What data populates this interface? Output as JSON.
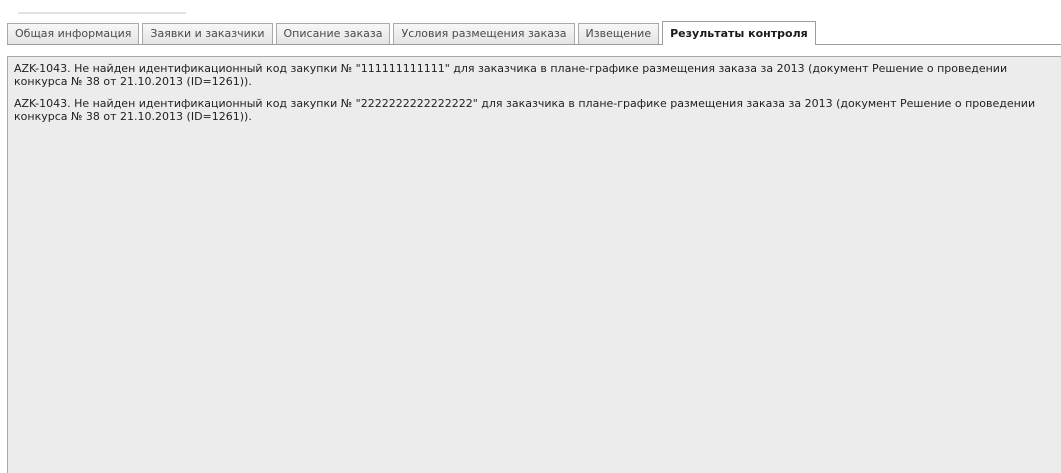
{
  "tabs": [
    {
      "label": "Общая информация",
      "active": false
    },
    {
      "label": "Заявки и заказчики",
      "active": false
    },
    {
      "label": "Описание заказа",
      "active": false
    },
    {
      "label": "Условия размещения заказа",
      "active": false
    },
    {
      "label": "Извещение",
      "active": false
    },
    {
      "label": "Результаты контроля",
      "active": true
    }
  ],
  "messages": [
    "AZK-1043. Не найден идентификационный код закупки № \"111111111111\" для заказчика в плане-графике размещения заказа за 2013 (документ Решение о проведении конкурса № 38 от 21.10.2013 (ID=1261)).",
    "AZK-1043. Не найден идентификационный код закупки № \"2222222222222222\" для заказчика в плане-графике размещения заказа за 2013 (документ Решение о проведении конкурса № 38 от 21.10.2013 (ID=1261))."
  ],
  "colors": {
    "panel_background": "#ececec",
    "tab_border": "#a9a9a9",
    "text": "#1f1f1f"
  }
}
